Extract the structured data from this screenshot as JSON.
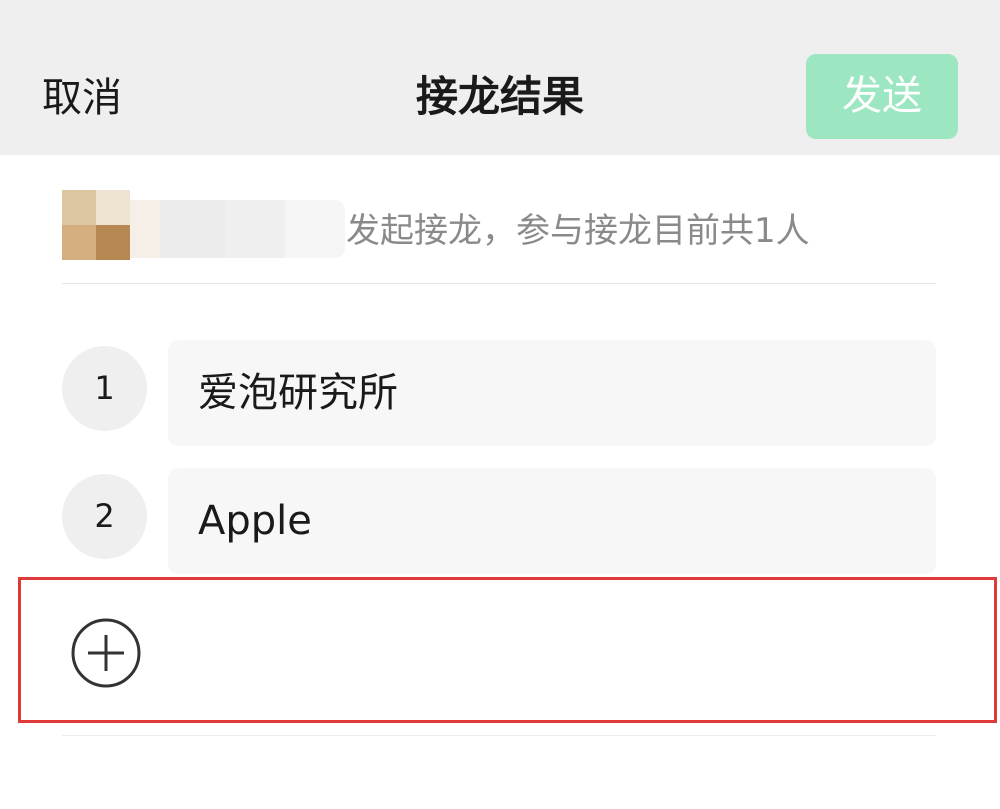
{
  "header": {
    "cancel_label": "取消",
    "title": "接龙结果",
    "send_label": "发送"
  },
  "initiator": {
    "text": "发起接龙，参与接龙目前共1人"
  },
  "entries": [
    {
      "number": "1",
      "value": "爱泡研究所"
    },
    {
      "number": "2",
      "value": "Apple"
    }
  ],
  "add_row": {
    "icon": "plus-circle-icon"
  },
  "colors": {
    "header_bg": "#efefef",
    "send_button_bg": "#9ce6c1",
    "highlight_border": "#e0393a"
  }
}
